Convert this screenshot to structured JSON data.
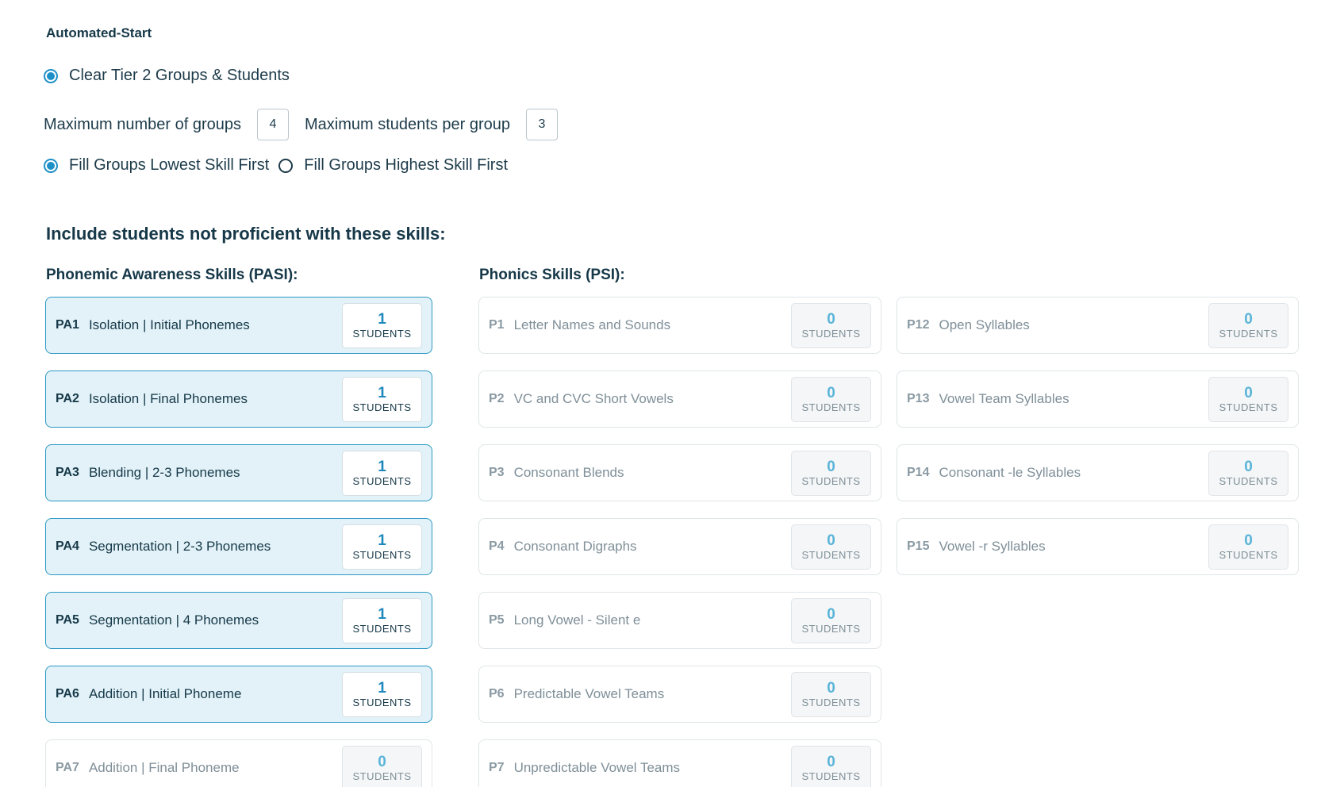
{
  "section_title": "Automated-Start",
  "clear_option": {
    "label": "Clear Tier 2 Groups & Students",
    "checked": true
  },
  "max_groups": {
    "label": "Maximum number of groups",
    "value": "4"
  },
  "max_students": {
    "label": "Maximum students per group",
    "value": "3"
  },
  "fill_options": [
    {
      "label": "Fill Groups Lowest Skill First",
      "checked": true
    },
    {
      "label": "Fill Groups Highest Skill First",
      "checked": false
    }
  ],
  "heading": "Include students not proficient with these skills:",
  "colors": {
    "accent": "#1e90c8",
    "active_bg": "#e2f2f8",
    "text": "#163848"
  },
  "pasi": {
    "title": "Phonemic Awareness Skills (PASI):",
    "items": [
      {
        "code": "PA1",
        "name": "Isolation | Initial Phonemes",
        "count": "1",
        "unit": "STUDENTS",
        "active": true
      },
      {
        "code": "PA2",
        "name": "Isolation | Final Phonemes",
        "count": "1",
        "unit": "STUDENTS",
        "active": true
      },
      {
        "code": "PA3",
        "name": "Blending | 2-3 Phonemes",
        "count": "1",
        "unit": "STUDENTS",
        "active": true
      },
      {
        "code": "PA4",
        "name": "Segmentation | 2-3 Phonemes",
        "count": "1",
        "unit": "STUDENTS",
        "active": true
      },
      {
        "code": "PA5",
        "name": "Segmentation | 4 Phonemes",
        "count": "1",
        "unit": "STUDENTS",
        "active": true
      },
      {
        "code": "PA6",
        "name": "Addition | Initial Phoneme",
        "count": "1",
        "unit": "STUDENTS",
        "active": true
      },
      {
        "code": "PA7",
        "name": "Addition | Final Phoneme",
        "count": "0",
        "unit": "STUDENTS",
        "active": false
      }
    ]
  },
  "psi": {
    "title": "Phonics Skills (PSI):",
    "col1": [
      {
        "code": "P1",
        "name": "Letter Names and Sounds",
        "count": "0",
        "unit": "STUDENTS",
        "active": false
      },
      {
        "code": "P2",
        "name": "VC and CVC Short Vowels",
        "count": "0",
        "unit": "STUDENTS",
        "active": false
      },
      {
        "code": "P3",
        "name": "Consonant Blends",
        "count": "0",
        "unit": "STUDENTS",
        "active": false
      },
      {
        "code": "P4",
        "name": "Consonant Digraphs",
        "count": "0",
        "unit": "STUDENTS",
        "active": false
      },
      {
        "code": "P5",
        "name": "Long Vowel - Silent e",
        "count": "0",
        "unit": "STUDENTS",
        "active": false
      },
      {
        "code": "P6",
        "name": "Predictable Vowel Teams",
        "count": "0",
        "unit": "STUDENTS",
        "active": false
      },
      {
        "code": "P7",
        "name": "Unpredictable Vowel Teams",
        "count": "0",
        "unit": "STUDENTS",
        "active": false
      }
    ],
    "col2": [
      {
        "code": "P12",
        "name": "Open Syllables",
        "count": "0",
        "unit": "STUDENTS",
        "active": false
      },
      {
        "code": "P13",
        "name": "Vowel Team Syllables",
        "count": "0",
        "unit": "STUDENTS",
        "active": false
      },
      {
        "code": "P14",
        "name": "Consonant -le Syllables",
        "count": "0",
        "unit": "STUDENTS",
        "active": false
      },
      {
        "code": "P15",
        "name": "Vowel -r Syllables",
        "count": "0",
        "unit": "STUDENTS",
        "active": false
      }
    ]
  }
}
